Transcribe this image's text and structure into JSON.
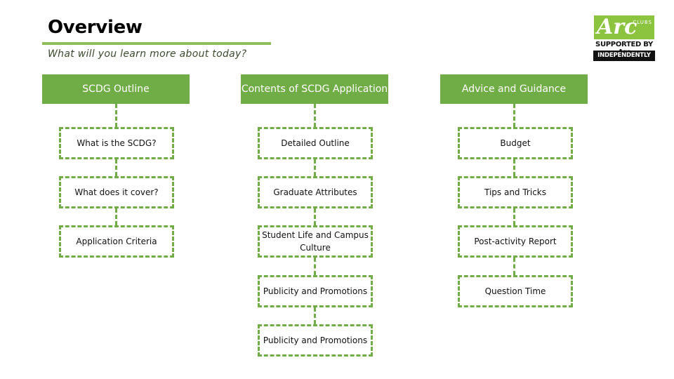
{
  "header": {
    "title": "Overview",
    "subtitle": "What will you learn more about today?"
  },
  "logo": {
    "brand": "Arc",
    "clubs": "CLUBS",
    "supported": "SUPPORTED BY Arc",
    "independently": "INDEPENDENTLY RUN",
    "accent_color": "#8cc43f"
  },
  "colors": {
    "header_fill": "#70ad47",
    "dashed_border": "#70ad47",
    "rule": "#8fbd5a"
  },
  "columns": [
    {
      "title": "SCDG Outline",
      "items": [
        "What is the SCDG?",
        "What does it cover?",
        "Application Criteria"
      ]
    },
    {
      "title": "Contents of SCDG Application",
      "items": [
        "Detailed Outline",
        "Graduate Attributes",
        "Student Life and Campus Culture",
        "Publicity and Promotions",
        "Publicity and Promotions"
      ]
    },
    {
      "title": "Advice and Guidance",
      "items": [
        "Budget",
        "Tips and Tricks",
        "Post-activity Report",
        "Question Time"
      ]
    }
  ]
}
